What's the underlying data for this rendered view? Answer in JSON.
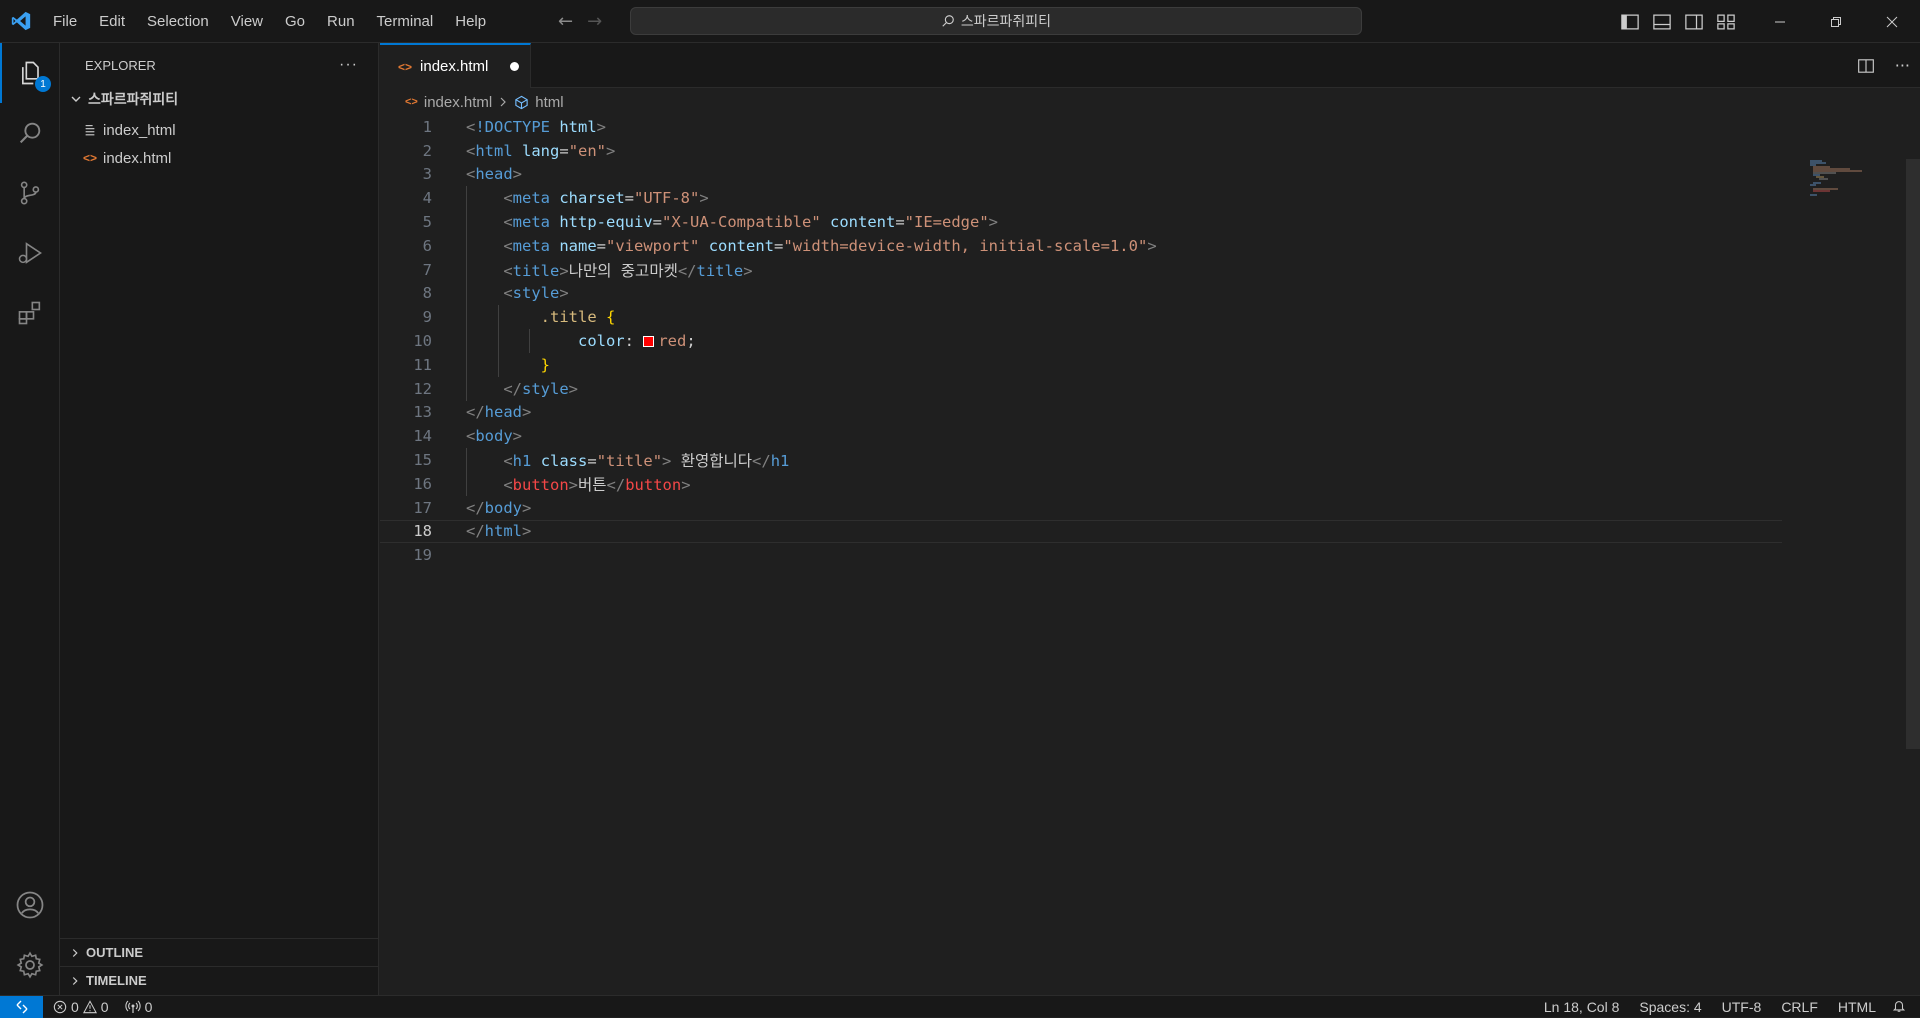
{
  "menu": [
    "File",
    "Edit",
    "Selection",
    "View",
    "Go",
    "Run",
    "Terminal",
    "Help"
  ],
  "search_text": "스파르파쥐피티",
  "activity": {
    "explorer_badge": "1"
  },
  "sidebar": {
    "title": "EXPLORER",
    "folder": "스파르파쥐피티",
    "files": [
      {
        "name": "index_html",
        "icon": "file-lines-icon"
      },
      {
        "name": "index.html",
        "icon": "html-icon"
      }
    ],
    "outline": "OUTLINE",
    "timeline": "TIMELINE"
  },
  "tab": {
    "label": "index.html",
    "modified": true
  },
  "breadcrumb": {
    "file": "index.html",
    "symbol": "html"
  },
  "code_lines": [
    "<!DOCTYPE html>",
    "<html lang=\"en\">",
    "<head>",
    "    <meta charset=\"UTF-8\">",
    "    <meta http-equiv=\"X-UA-Compatible\" content=\"IE=edge\">",
    "    <meta name=\"viewport\" content=\"width=device-width, initial-scale=1.0\">",
    "    <title>나만의 중고마켓</title>",
    "    <style>",
    "        .title {",
    "            color: red;",
    "        }",
    "    </style>",
    "</head>",
    "<body>",
    "    <h1 class=\"title\"> 환영합니다</h1",
    "    <button>버튼</button>",
    "</body>",
    "</html>",
    ""
  ],
  "current_line": 18,
  "status": {
    "errors": "0",
    "warnings": "0",
    "ports": "0",
    "position": "Ln 18, Col 8",
    "spaces": "Spaces: 4",
    "encoding": "UTF-8",
    "eol": "CRLF",
    "language": "HTML"
  },
  "colors": {
    "accent": "#0078d4",
    "swatch_red": "#ff0000"
  }
}
